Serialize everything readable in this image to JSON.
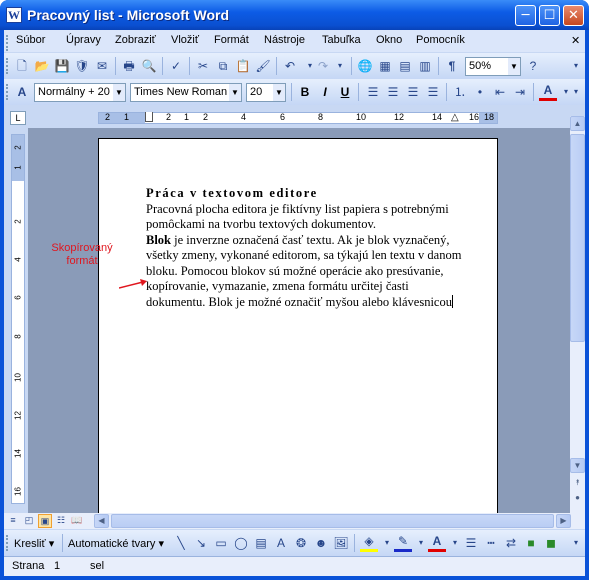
{
  "window": {
    "title": "Pracovný list - Microsoft Word",
    "app_icon": "W",
    "minimize_icon": "─",
    "maximize_icon": "☐",
    "close_icon": "✕"
  },
  "menu": [
    "Súbor",
    "Úpravy",
    "Zobraziť",
    "Vložiť",
    "Formát",
    "Nástroje",
    "Tabuľka",
    "Okno",
    "Pomocník"
  ],
  "menu_close_icon": "✕",
  "toolbar1": {
    "icons": [
      "new-document-icon",
      "open-icon",
      "save-icon",
      "permission-icon",
      "email-icon",
      "print-icon",
      "print-preview-icon",
      "spelling-icon",
      "cut-icon",
      "copy-icon",
      "paste-icon",
      "format-painter-icon",
      "undo-icon",
      "redo-icon",
      "hyperlink-icon",
      "tables-borders-icon",
      "insert-table-icon",
      "columns-icon",
      "show-formatting-icon"
    ],
    "zoom": "50%"
  },
  "toolbar2": {
    "style": "Normálny + 20",
    "font": "Times New Roman",
    "size": "20",
    "icons": [
      "styles-icon",
      "bold-icon",
      "italic-icon",
      "underline-icon",
      "align-left-icon",
      "align-center-icon",
      "align-right-icon",
      "justify-icon",
      "numbering-icon",
      "bullets-icon",
      "decrease-indent-icon",
      "increase-indent-icon",
      "font-color-icon"
    ]
  },
  "ruler": {
    "tab_selector": "L",
    "numbers": [
      "2",
      "1",
      "2",
      "1",
      "2",
      "4",
      "6",
      "8",
      "10",
      "12",
      "14",
      "16",
      "18"
    ]
  },
  "vruler": {
    "numbers": [
      "2",
      "1",
      "2",
      "4",
      "6",
      "8",
      "10",
      "12",
      "14",
      "16"
    ]
  },
  "document": {
    "heading": "Práca v textovom editore",
    "para1": "Pracovná plocha editora je fiktívny list papiera s potrebnými pomôckami na tvorbu textových dokumentov.",
    "bold_word": "Blok",
    "para2": " je inverzne označená časť textu. Ak je blok vyznačený, všetky zmeny, vykonané editorom, sa týkajú len textu v danom bloku. Pomocou blokov sú možné operácie ako presúvanie, kopírovanie, vymazanie, zmena formátu určitej časti dokumentu. Blok je možné označiť myšou alebo klávesnicou"
  },
  "annotation": {
    "text": "Skopírovaný formát",
    "color": "#e0161e"
  },
  "drawbar": {
    "draw": "Kresliť",
    "autoshapes": "Automatické tvary"
  },
  "status": {
    "page": "Strana",
    "page_num": "1",
    "section": "sel"
  },
  "colors": {
    "titlebar": "#0a4fd0",
    "menubar": "#dbe6fa",
    "toolbar": "#c5d7f5",
    "doc_bg": "#8a9bb8"
  }
}
